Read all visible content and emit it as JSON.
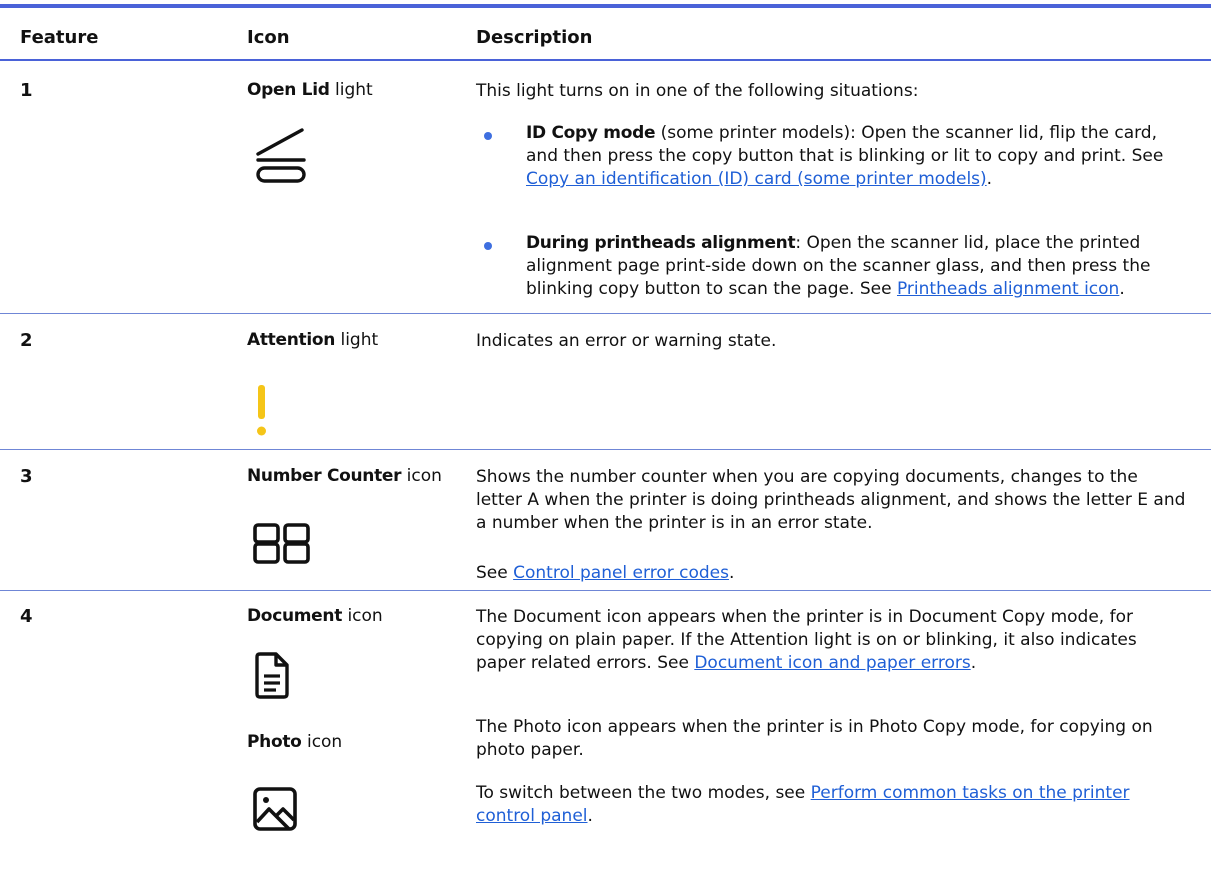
{
  "table": {
    "headers": {
      "feature": "Feature",
      "icon": "Icon",
      "description": "Description"
    },
    "rows": [
      {
        "feature": "1",
        "icon_name_bold": "Open Lid",
        "icon_name_rest": " light",
        "icon": "open-lid-icon",
        "description_intro": "This light turns on in one of the following situations:",
        "bullets": [
          {
            "bold": "ID Copy mode",
            "text": " (some printer models): Open the scanner lid, flip the card, and then press the copy button that is blinking or lit to copy and print. See ",
            "link": "Copy an identification (ID) card (some printer models)",
            "after": "."
          },
          {
            "bold": "During printheads alignment",
            "text": ": Open the scanner lid, place the printed alignment page print-side down on the scanner glass, and then press the blinking copy button to scan the page. See ",
            "link": "Printheads alignment icon",
            "after": "."
          }
        ]
      },
      {
        "feature": "2",
        "icon_name_bold": "Attention",
        "icon_name_rest": " light",
        "icon": "attention-icon",
        "description": "Indicates an error or warning state."
      },
      {
        "feature": "3",
        "icon_name_bold": "Number Counter",
        "icon_name_rest": " icon",
        "icon": "number-counter-icon",
        "description": "Shows the number counter when you are copying documents, changes to the letter A when the printer is doing printheads alignment, and shows the letter E and a number when the printer is in an error state.",
        "see_text": "See ",
        "see_link": "Control panel error codes",
        "see_after": "."
      },
      {
        "feature": "4",
        "icon_name_bold": "Document",
        "icon_name_rest": " icon",
        "icon": "document-icon",
        "description": "The Document icon appears when the printer is in Document Copy mode, for copying on plain paper. If the Attention light is on or blinking, it also indicates paper related errors. See ",
        "description_link": "Document icon and paper errors",
        "description_after": ".",
        "sub_icon_name_bold": "Photo",
        "sub_icon_name_rest": " icon",
        "sub_icon": "photo-icon",
        "sub_description": "The Photo icon appears when the printer is in Photo Copy mode, for copying on photo paper.",
        "switch_text": "To switch between the two modes, see ",
        "switch_link": "Perform common tasks on the printer control panel",
        "switch_after": "."
      }
    ]
  },
  "colors": {
    "rule": "#4a62d8",
    "link": "#1f5fd6",
    "bullet": "#3e6fe0",
    "attention": "#f5c518"
  }
}
